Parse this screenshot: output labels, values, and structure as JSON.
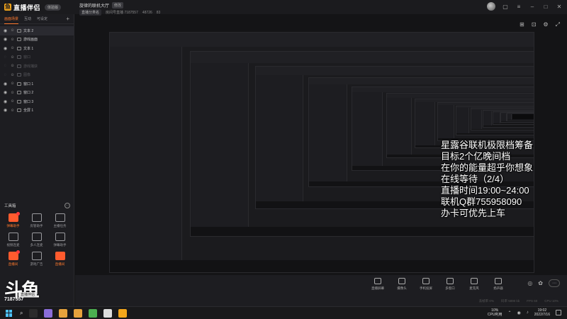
{
  "app": {
    "name": "直播伴侣",
    "version_badge": "体验版"
  },
  "sidebar": {
    "tabs": [
      {
        "label": "画面场景",
        "active": true
      },
      {
        "label": "互动",
        "active": false
      },
      {
        "label": "可设定",
        "active": false
      }
    ],
    "scene_items": [
      {
        "label": "文本 2",
        "visible": true,
        "selected": true
      },
      {
        "label": "游戏画面",
        "visible": true,
        "selected": false
      },
      {
        "label": "文本 1",
        "visible": true,
        "selected": false
      },
      {
        "label": "窗口",
        "visible": false,
        "selected": false
      },
      {
        "label": "游戏捕获",
        "visible": false,
        "selected": false
      },
      {
        "label": "图像",
        "visible": false,
        "selected": false
      },
      {
        "label": "窗口 1",
        "visible": true,
        "selected": false
      },
      {
        "label": "窗口 2",
        "visible": true,
        "selected": false
      },
      {
        "label": "窗口 3",
        "visible": true,
        "selected": false
      },
      {
        "label": "全屏 1",
        "visible": true,
        "selected": false
      }
    ],
    "toolbox_title": "工具箱",
    "tools": [
      {
        "label": "弹幕助手",
        "hot": true,
        "badge": true
      },
      {
        "label": "房管助手",
        "hot": false,
        "badge": false
      },
      {
        "label": "主播任务",
        "hot": false,
        "badge": false
      },
      {
        "label": "视频连麦",
        "hot": false,
        "badge": false
      },
      {
        "label": "多人连麦",
        "hot": false,
        "badge": false
      },
      {
        "label": "弹幕助手",
        "hot": false,
        "badge": false
      },
      {
        "label": "直播间",
        "hot": true,
        "badge": true
      },
      {
        "label": "游戏广告",
        "hot": false,
        "badge": false
      },
      {
        "label": "直播间",
        "hot": true,
        "badge": false
      }
    ]
  },
  "watermark": {
    "big": "斗鱼",
    "tag": "直播伴侣",
    "room_id": "7187557"
  },
  "header": {
    "stream_title": "旋律的联机大厅",
    "edit_label": "修改",
    "meta": [
      "直播分类名",
      "房间号直播 7187557",
      "48726",
      "83"
    ]
  },
  "overlay_lines": [
    "星露谷联机极限档筹备",
    "目标2个亿晚间档",
    "在你的能量超乎你想象",
    "在线等待（2/4）",
    "直播时间19:00~24:00",
    "联机Q群755958090",
    "办卡可优先上车"
  ],
  "controls": [
    {
      "label": "直播屏幕",
      "icon": "screen-icon"
    },
    {
      "label": "摄像头",
      "icon": "camera-icon"
    },
    {
      "label": "手机投屏",
      "icon": "phone-icon"
    },
    {
      "label": "多窗口",
      "icon": "window-icon"
    },
    {
      "label": "麦克风",
      "icon": "mic-icon"
    },
    {
      "label": "扬声器",
      "icon": "speaker-icon"
    }
  ],
  "status_line": [
    "丢帧率 0%",
    "码率 5890 kb",
    "FPS 60",
    "CPU 10%"
  ],
  "taskbar": {
    "apps": [
      "#2b2b2b",
      "#8a6dd8",
      "#e6a23c",
      "#e6a23c",
      "#4caf50",
      "#dddddd",
      "#f4a61b"
    ],
    "cpu_value": "10%",
    "cpu_label": "CPU利用",
    "time": "19:02",
    "date": "2022/7/16"
  }
}
